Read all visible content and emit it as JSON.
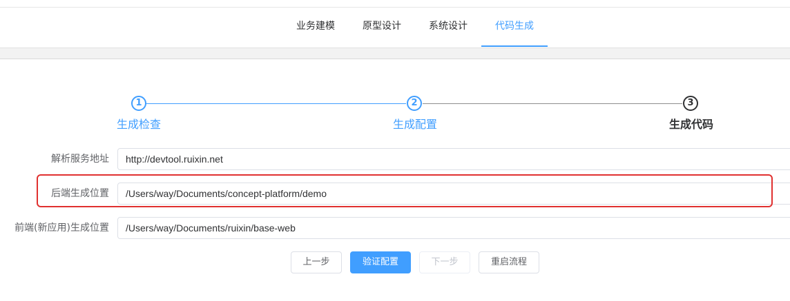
{
  "tabs": [
    {
      "label": "业务建模",
      "active": false
    },
    {
      "label": "原型设计",
      "active": false
    },
    {
      "label": "系统设计",
      "active": false
    },
    {
      "label": "代码生成",
      "active": true
    }
  ],
  "steps": [
    {
      "number": "1",
      "title": "生成检查",
      "status": "finished"
    },
    {
      "number": "2",
      "title": "生成配置",
      "status": "finished"
    },
    {
      "number": "3",
      "title": "生成代码",
      "status": "current"
    }
  ],
  "form": {
    "parse_service": {
      "label": "解析服务地址",
      "value": "http://devtool.ruixin.net"
    },
    "backend_location": {
      "label": "后端生成位置",
      "value": "/Users/way/Documents/concept-platform/demo"
    },
    "frontend_location": {
      "label": "前端(新应用)生成位置",
      "value": "/Users/way/Documents/ruixin/base-web"
    }
  },
  "buttons": {
    "prev": "上一步",
    "verify": "验证配置",
    "next": "下一步",
    "restart": "重启流程"
  },
  "colors": {
    "accent": "#409eff",
    "highlight_border": "#e0302f",
    "step_pending": "#303133"
  }
}
